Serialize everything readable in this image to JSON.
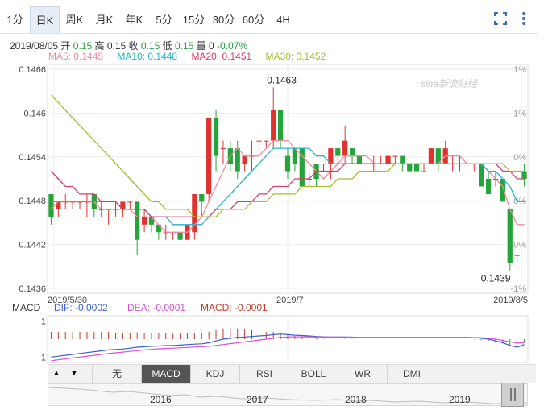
{
  "tabs": [
    "1分",
    "日K",
    "周K",
    "月K",
    "年K",
    "5分",
    "15分",
    "30分",
    "60分",
    "4H"
  ],
  "active_tab": "日K",
  "quote": {
    "date": "2019/08/05",
    "open_label": "开",
    "open": "0.15",
    "high_label": "高",
    "high": "0.15",
    "close_label": "收",
    "close": "0.15",
    "low_label": "低",
    "low": "0.15",
    "volume_label": "量",
    "volume": "0",
    "change": "-0.07%"
  },
  "ma": {
    "ma5": "MA5: 0.1445",
    "ma10": "MA10: 0.1448",
    "ma20": "MA20: 0.1451",
    "ma30": "MA30: 0.1452",
    "colors": {
      "ma5": "#f08ca0",
      "ma10": "#2bb3c8",
      "ma20": "#d63c6e",
      "ma30": "#a6bd2c"
    }
  },
  "watermark": "sina新浪财经",
  "annotations": {
    "high": "0.1463",
    "low": "0.1439"
  },
  "macd_legend": {
    "name": "MACD",
    "dif": "DIF: -0.0002",
    "dea": "DEA: -0.0001",
    "macd": "MACD: -0.0001"
  },
  "indicator_tabs": [
    "无",
    "MACD",
    "KDJ",
    "RSI",
    "BOLL",
    "WR",
    "DMI"
  ],
  "active_indicator": "MACD",
  "navigator_years": [
    "2016",
    "2017",
    "2018",
    "2019"
  ],
  "chart_data": {
    "type": "candlestick",
    "x_tick_labels": [
      "2019/5/30",
      "2019/7",
      "2019/8/5"
    ],
    "y_left_ticks": [
      "0.1466",
      "0.146",
      "0.1454",
      "0.1448",
      "0.1442",
      "0.1436"
    ],
    "y_right_ticks": [
      "1%",
      "1%",
      "0%",
      "0%",
      "-0%",
      "-1%"
    ],
    "ylim": [
      0.1436,
      0.1466
    ],
    "candles": [
      [
        0.1449,
        0.1446,
        0.1449,
        0.1445
      ],
      [
        0.1447,
        0.1448,
        0.1448,
        0.1446
      ],
      [
        0.1448,
        0.1448,
        0.1449,
        0.1447
      ],
      [
        0.1448,
        0.1448,
        0.1448,
        0.1447
      ],
      [
        0.1448,
        0.1448,
        0.1448,
        0.1447
      ],
      [
        0.1448,
        0.1448,
        0.1449,
        0.1446
      ],
      [
        0.1449,
        0.1447,
        0.1449,
        0.1446
      ],
      [
        0.1447,
        0.1447,
        0.1448,
        0.1446
      ],
      [
        0.1447,
        0.1447,
        0.1447,
        0.1445
      ],
      [
        0.1447,
        0.1447,
        0.1448,
        0.1446
      ],
      [
        0.1447,
        0.1448,
        0.1448,
        0.1446
      ],
      [
        0.1448,
        0.1448,
        0.1448,
        0.1447
      ],
      [
        0.1448,
        0.1443,
        0.1448,
        0.1441
      ],
      [
        0.1445,
        0.1446,
        0.1447,
        0.1444
      ],
      [
        0.1446,
        0.1445,
        0.1446,
        0.1444
      ],
      [
        0.1445,
        0.1444,
        0.1445,
        0.1443
      ],
      [
        0.1444,
        0.1444,
        0.1445,
        0.1443
      ],
      [
        0.1444,
        0.1444,
        0.1444,
        0.1443
      ],
      [
        0.1444,
        0.1443,
        0.1444,
        0.1443
      ],
      [
        0.1443,
        0.1445,
        0.1445,
        0.1443
      ],
      [
        0.1444,
        0.1449,
        0.1449,
        0.1443
      ],
      [
        0.1449,
        0.1448,
        0.1449,
        0.1446
      ],
      [
        0.1449,
        0.1459,
        0.1459,
        0.1448
      ],
      [
        0.1459,
        0.1454,
        0.146,
        0.1452
      ],
      [
        0.1455,
        0.1455,
        0.1456,
        0.1453
      ],
      [
        0.1455,
        0.1453,
        0.1456,
        0.1452
      ],
      [
        0.1455,
        0.1452,
        0.1456,
        0.1451
      ],
      [
        0.1453,
        0.1454,
        0.1454,
        0.1452
      ],
      [
        0.1454,
        0.1454,
        0.1456,
        0.1452
      ],
      [
        0.1456,
        0.1456,
        0.1456,
        0.1454
      ],
      [
        0.1456,
        0.1456,
        0.1456,
        0.1455
      ],
      [
        0.1456,
        0.146,
        0.1463,
        0.1455
      ],
      [
        0.146,
        0.1456,
        0.146,
        0.1455
      ],
      [
        0.1454,
        0.1452,
        0.1455,
        0.1451
      ],
      [
        0.1455,
        0.1453,
        0.1455,
        0.1452
      ],
      [
        0.1455,
        0.145,
        0.1455,
        0.145
      ],
      [
        0.1451,
        0.1451,
        0.1452,
        0.145
      ],
      [
        0.1453,
        0.1451,
        0.1453,
        0.145
      ],
      [
        0.1453,
        0.1453,
        0.1453,
        0.1452
      ],
      [
        0.1453,
        0.1455,
        0.1455,
        0.1451
      ],
      [
        0.1455,
        0.1454,
        0.1455,
        0.1452
      ],
      [
        0.1454,
        0.1456,
        0.1458,
        0.1453
      ],
      [
        0.1455,
        0.1454,
        0.1455,
        0.1453
      ],
      [
        0.1454,
        0.1453,
        0.1454,
        0.1453
      ],
      [
        0.1453,
        0.1453,
        0.1453,
        0.1453
      ],
      [
        0.1453,
        0.1453,
        0.1454,
        0.1452
      ],
      [
        0.1453,
        0.1453,
        0.1454,
        0.1453
      ],
      [
        0.1453,
        0.1454,
        0.1455,
        0.1452
      ],
      [
        0.1454,
        0.1454,
        0.1454,
        0.1453
      ],
      [
        0.1454,
        0.1453,
        0.1454,
        0.1452
      ],
      [
        0.1453,
        0.1452,
        0.1453,
        0.1452
      ],
      [
        0.1453,
        0.1452,
        0.1453,
        0.1452
      ],
      [
        0.1452,
        0.1452,
        0.1453,
        0.1452
      ],
      [
        0.1453,
        0.1455,
        0.1455,
        0.1453
      ],
      [
        0.1455,
        0.1453,
        0.1455,
        0.1452
      ],
      [
        0.1453,
        0.1455,
        0.1456,
        0.1453
      ],
      [
        0.1453,
        0.1453,
        0.1454,
        0.1452
      ],
      [
        0.1453,
        0.1453,
        0.1454,
        0.1452
      ],
      [
        0.1453,
        0.1453,
        0.1453,
        0.1453
      ],
      [
        0.1453,
        0.1453,
        0.1453,
        0.1452
      ],
      [
        0.1453,
        0.145,
        0.1453,
        0.145
      ],
      [
        0.1451,
        0.1449,
        0.1452,
        0.1449
      ],
      [
        0.1451,
        0.1451,
        0.1452,
        0.145
      ],
      [
        0.1451,
        0.1448,
        0.1451,
        0.1448
      ],
      [
        0.1447,
        0.144,
        0.1447,
        0.1439
      ],
      [
        0.1441,
        0.1441,
        0.1441,
        0.144
      ],
      [
        0.1452,
        0.1451,
        0.1453,
        0.145
      ]
    ],
    "ma5_values": [
      0.1447,
      0.1448,
      0.1448,
      0.1448,
      0.1448,
      0.1448,
      0.1448,
      0.1447,
      0.1447,
      0.1447,
      0.1447,
      0.1447,
      0.1446,
      0.1446,
      0.1446,
      0.1445,
      0.1444,
      0.1444,
      0.1444,
      0.1444,
      0.1445,
      0.1446,
      0.1448,
      0.145,
      0.1452,
      0.1454,
      0.1455,
      0.1454,
      0.1454,
      0.1454,
      0.1455,
      0.1456,
      0.1456,
      0.1456,
      0.1455,
      0.1454,
      0.1453,
      0.1452,
      0.1451,
      0.1452,
      0.1453,
      0.1454,
      0.1454,
      0.1454,
      0.1454,
      0.1453,
      0.1453,
      0.1453,
      0.1453,
      0.1453,
      0.1453,
      0.1453,
      0.1453,
      0.1453,
      0.1453,
      0.1454,
      0.1454,
      0.1454,
      0.1453,
      0.1453,
      0.1453,
      0.1452,
      0.1451,
      0.145,
      0.1447,
      0.1445,
      0.1445
    ],
    "ma10_values": [
      0.1448,
      0.1448,
      0.1448,
      0.1448,
      0.1448,
      0.1448,
      0.1448,
      0.1448,
      0.1448,
      0.1448,
      0.1447,
      0.1447,
      0.1447,
      0.1447,
      0.1446,
      0.1446,
      0.1446,
      0.1445,
      0.1445,
      0.1445,
      0.1445,
      0.1445,
      0.1446,
      0.1447,
      0.1448,
      0.1449,
      0.145,
      0.1451,
      0.1452,
      0.1453,
      0.1454,
      0.1455,
      0.1455,
      0.1455,
      0.1455,
      0.1455,
      0.1455,
      0.1454,
      0.1454,
      0.1453,
      0.1453,
      0.1453,
      0.1453,
      0.1453,
      0.1453,
      0.1453,
      0.1453,
      0.1453,
      0.1453,
      0.1453,
      0.1453,
      0.1453,
      0.1453,
      0.1453,
      0.1453,
      0.1453,
      0.1453,
      0.1453,
      0.1453,
      0.1453,
      0.1453,
      0.1452,
      0.1452,
      0.1451,
      0.145,
      0.1448,
      0.1448
    ],
    "ma20_values": [
      0.1452,
      0.1451,
      0.145,
      0.145,
      0.1449,
      0.1449,
      0.1449,
      0.1448,
      0.1448,
      0.1448,
      0.1447,
      0.1447,
      0.1447,
      0.1447,
      0.1446,
      0.1446,
      0.1446,
      0.1446,
      0.1446,
      0.1446,
      0.1446,
      0.1446,
      0.1446,
      0.1447,
      0.1447,
      0.1447,
      0.1448,
      0.1448,
      0.1448,
      0.1449,
      0.1449,
      0.145,
      0.145,
      0.145,
      0.1451,
      0.1451,
      0.1451,
      0.1452,
      0.1452,
      0.1452,
      0.1452,
      0.1453,
      0.1453,
      0.1453,
      0.1453,
      0.1453,
      0.1453,
      0.1453,
      0.1453,
      0.1453,
      0.1453,
      0.1453,
      0.1453,
      0.1453,
      0.1453,
      0.1453,
      0.1453,
      0.1453,
      0.1453,
      0.1453,
      0.1453,
      0.1453,
      0.1453,
      0.1452,
      0.1452,
      0.1451,
      0.1451
    ],
    "ma30_values": [
      0.1462,
      0.1461,
      0.146,
      0.1459,
      0.1458,
      0.1457,
      0.1456,
      0.1455,
      0.1454,
      0.1453,
      0.1452,
      0.1451,
      0.145,
      0.1449,
      0.1448,
      0.1448,
      0.1447,
      0.1447,
      0.1447,
      0.1447,
      0.1446,
      0.1446,
      0.1446,
      0.1446,
      0.1447,
      0.1447,
      0.1447,
      0.1447,
      0.1448,
      0.1448,
      0.1448,
      0.1449,
      0.1449,
      0.1449,
      0.1449,
      0.145,
      0.145,
      0.145,
      0.145,
      0.145,
      0.1451,
      0.1451,
      0.1451,
      0.1452,
      0.1452,
      0.1452,
      0.1452,
      0.1452,
      0.1453,
      0.1453,
      0.1453,
      0.1453,
      0.1453,
      0.1453,
      0.1453,
      0.1453,
      0.1453,
      0.1453,
      0.1453,
      0.1453,
      0.1453,
      0.1453,
      0.1453,
      0.1453,
      0.1452,
      0.1452,
      0.1452
    ],
    "macd_ticks": [
      "1",
      "-1"
    ],
    "macd_ylim": [
      -1.3,
      1.3
    ],
    "dif_values": [
      -1.0,
      -0.95,
      -0.9,
      -0.85,
      -0.8,
      -0.75,
      -0.7,
      -0.65,
      -0.6,
      -0.58,
      -0.55,
      -0.5,
      -0.45,
      -0.42,
      -0.4,
      -0.38,
      -0.36,
      -0.35,
      -0.33,
      -0.3,
      -0.28,
      -0.26,
      -0.2,
      -0.1,
      0.0,
      0.05,
      0.1,
      0.12,
      0.15,
      0.18,
      0.2,
      0.25,
      0.28,
      0.25,
      0.22,
      0.2,
      0.18,
      0.15,
      0.13,
      0.12,
      0.12,
      0.12,
      0.11,
      0.1,
      0.1,
      0.1,
      0.1,
      0.1,
      0.1,
      0.1,
      0.1,
      0.1,
      0.1,
      0.1,
      0.1,
      0.1,
      0.1,
      0.1,
      0.1,
      0.08,
      0.05,
      0.0,
      -0.1,
      -0.2,
      -0.35,
      -0.45,
      -0.3
    ],
    "dea_values": [
      -1.2,
      -1.15,
      -1.1,
      -1.05,
      -1.0,
      -0.95,
      -0.9,
      -0.85,
      -0.8,
      -0.76,
      -0.72,
      -0.68,
      -0.64,
      -0.6,
      -0.57,
      -0.54,
      -0.52,
      -0.5,
      -0.48,
      -0.46,
      -0.44,
      -0.42,
      -0.4,
      -0.35,
      -0.3,
      -0.25,
      -0.2,
      -0.15,
      -0.1,
      -0.05,
      0.0,
      0.05,
      0.1,
      0.12,
      0.13,
      0.13,
      0.13,
      0.12,
      0.12,
      0.12,
      0.11,
      0.11,
      0.1,
      0.1,
      0.1,
      0.1,
      0.1,
      0.1,
      0.1,
      0.1,
      0.1,
      0.1,
      0.1,
      0.1,
      0.1,
      0.1,
      0.1,
      0.1,
      0.1,
      0.09,
      0.08,
      0.05,
      0.0,
      -0.08,
      -0.15,
      -0.22,
      -0.2
    ],
    "macd_hist": [
      0.4,
      0.4,
      0.4,
      0.4,
      0.4,
      0.4,
      0.4,
      0.4,
      0.4,
      0.36,
      0.34,
      0.36,
      0.38,
      0.36,
      0.34,
      0.32,
      0.32,
      0.3,
      0.3,
      0.32,
      0.32,
      0.32,
      0.4,
      0.5,
      0.6,
      0.6,
      0.6,
      0.54,
      0.5,
      0.46,
      0.4,
      0.4,
      0.36,
      0.26,
      0.18,
      0.14,
      0.1,
      0.06,
      0.02,
      0.0,
      0.02,
      0.02,
      0.02,
      0.0,
      0.0,
      0.0,
      0.0,
      0.0,
      0.0,
      0.0,
      0.0,
      0.0,
      0.0,
      0.0,
      0.0,
      0.0,
      0.0,
      0.0,
      0.0,
      -0.02,
      -0.06,
      -0.1,
      -0.2,
      -0.24,
      -0.4,
      -0.46,
      -0.2
    ],
    "colors": {
      "up": "#e0322e",
      "down": "#24a43a",
      "dif": "#3a5fd0",
      "dea": "#d94fd6",
      "hist": "#c0392b",
      "axis": "#aaaaaa",
      "grid": "#eeeeee"
    }
  }
}
